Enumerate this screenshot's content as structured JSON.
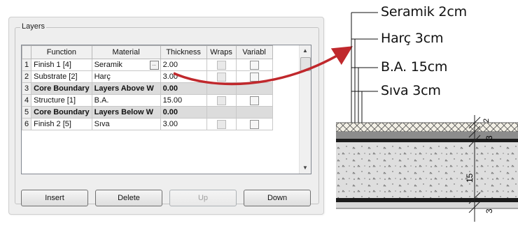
{
  "layers_group": {
    "title": "Layers"
  },
  "columns": [
    "Function",
    "Material",
    "Thickness",
    "Wraps",
    "Variabl"
  ],
  "rows": [
    {
      "num": "1",
      "function": "Finish 1 [4]",
      "material": "Seramik",
      "thickness": "2.00",
      "boundary": false
    },
    {
      "num": "2",
      "function": "Substrate [2]",
      "material": "Harç",
      "thickness": "3.00",
      "boundary": false
    },
    {
      "num": "3",
      "function": "Core Boundary",
      "material": "Layers Above W",
      "thickness": "0.00",
      "boundary": true
    },
    {
      "num": "4",
      "function": "Structure [1]",
      "material": "B.A.",
      "thickness": "15.00",
      "boundary": false
    },
    {
      "num": "5",
      "function": "Core Boundary",
      "material": "Layers Below W",
      "thickness": "0.00",
      "boundary": true
    },
    {
      "num": "6",
      "function": "Finish 2 [5]",
      "material": "Sıva",
      "thickness": "3.00",
      "boundary": false
    }
  ],
  "buttons": {
    "insert": "Insert",
    "delete": "Delete",
    "up": "Up",
    "down": "Down"
  },
  "section": {
    "labels": [
      "Seramik 2cm",
      "Harç 3cm",
      "B.A. 15cm",
      "Sıva 3cm"
    ],
    "dimensions": [
      "2",
      "3",
      "15",
      "3"
    ]
  },
  "colors": {
    "arrow": "#c0282c",
    "highlight_border": "#3a6fb0"
  },
  "icons": {
    "ellipsis": "ellipsis-icon",
    "scroll_up": "scroll-up-arrow-icon",
    "scroll_down": "scroll-down-arrow-icon"
  }
}
